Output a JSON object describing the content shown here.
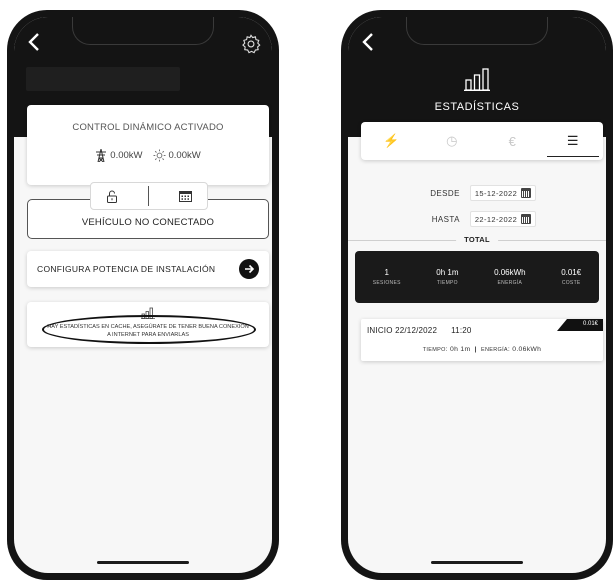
{
  "left_screen": {
    "control": {
      "title": "CONTROL DINÁMICO ACTIVADO",
      "grid_power": "0.00kW",
      "solar_power": "0.00kW"
    },
    "vehicle_status": "VEHÍCULO NO CONECTADO",
    "config_label": "CONFIGURA POTENCIA DE INSTALACIÓN",
    "cache_notice": "HAY ESTADÍSTICAS EN CACHE, ASEGÚRATE DE TENER BUENA CONEXIÓN A INTERNET PARA ENVIARLAS",
    "icons": [
      "back-icon",
      "gear-icon",
      "electric-tower-icon",
      "sun-icon",
      "unlock-icon",
      "calendar-icon",
      "arrow-right-icon",
      "bar-chart-icon"
    ]
  },
  "right_screen": {
    "title": "ESTADÍSTICAS",
    "tabs": [
      {
        "icon": "bolt-icon",
        "glyph": "⚡",
        "active": false
      },
      {
        "icon": "clock-icon",
        "glyph": "◷",
        "active": false
      },
      {
        "icon": "euro-icon",
        "glyph": "€",
        "active": false
      },
      {
        "icon": "list-icon",
        "glyph": "☰",
        "active": true
      }
    ],
    "desde_label": "DESDE",
    "desde_value": "15-12-2022",
    "hasta_label": "HASTA",
    "hasta_value": "22-12-2022",
    "total_label": "TOTAL",
    "totals": [
      {
        "value": "1",
        "label": "SESIONES"
      },
      {
        "value": "0h 1m",
        "label": "TIEMPO"
      },
      {
        "value": "0.06kWh",
        "label": "ENERGÍA"
      },
      {
        "value": "0.01€",
        "label": "COSTE"
      }
    ],
    "session": {
      "start_label": "INICIO 22/12/2022",
      "start_time": "11:20",
      "cost": "0.01€",
      "time_label": "TIEMPO",
      "time_value": ": 0h 1m",
      "energy_label": "ENERGÍA",
      "energy_value": ": 0.06kWh"
    }
  },
  "colors": {
    "dark": "#141414",
    "card": "#ffffff",
    "background": "#f7f7f7",
    "inactive_icon": "#c8c8c8"
  }
}
